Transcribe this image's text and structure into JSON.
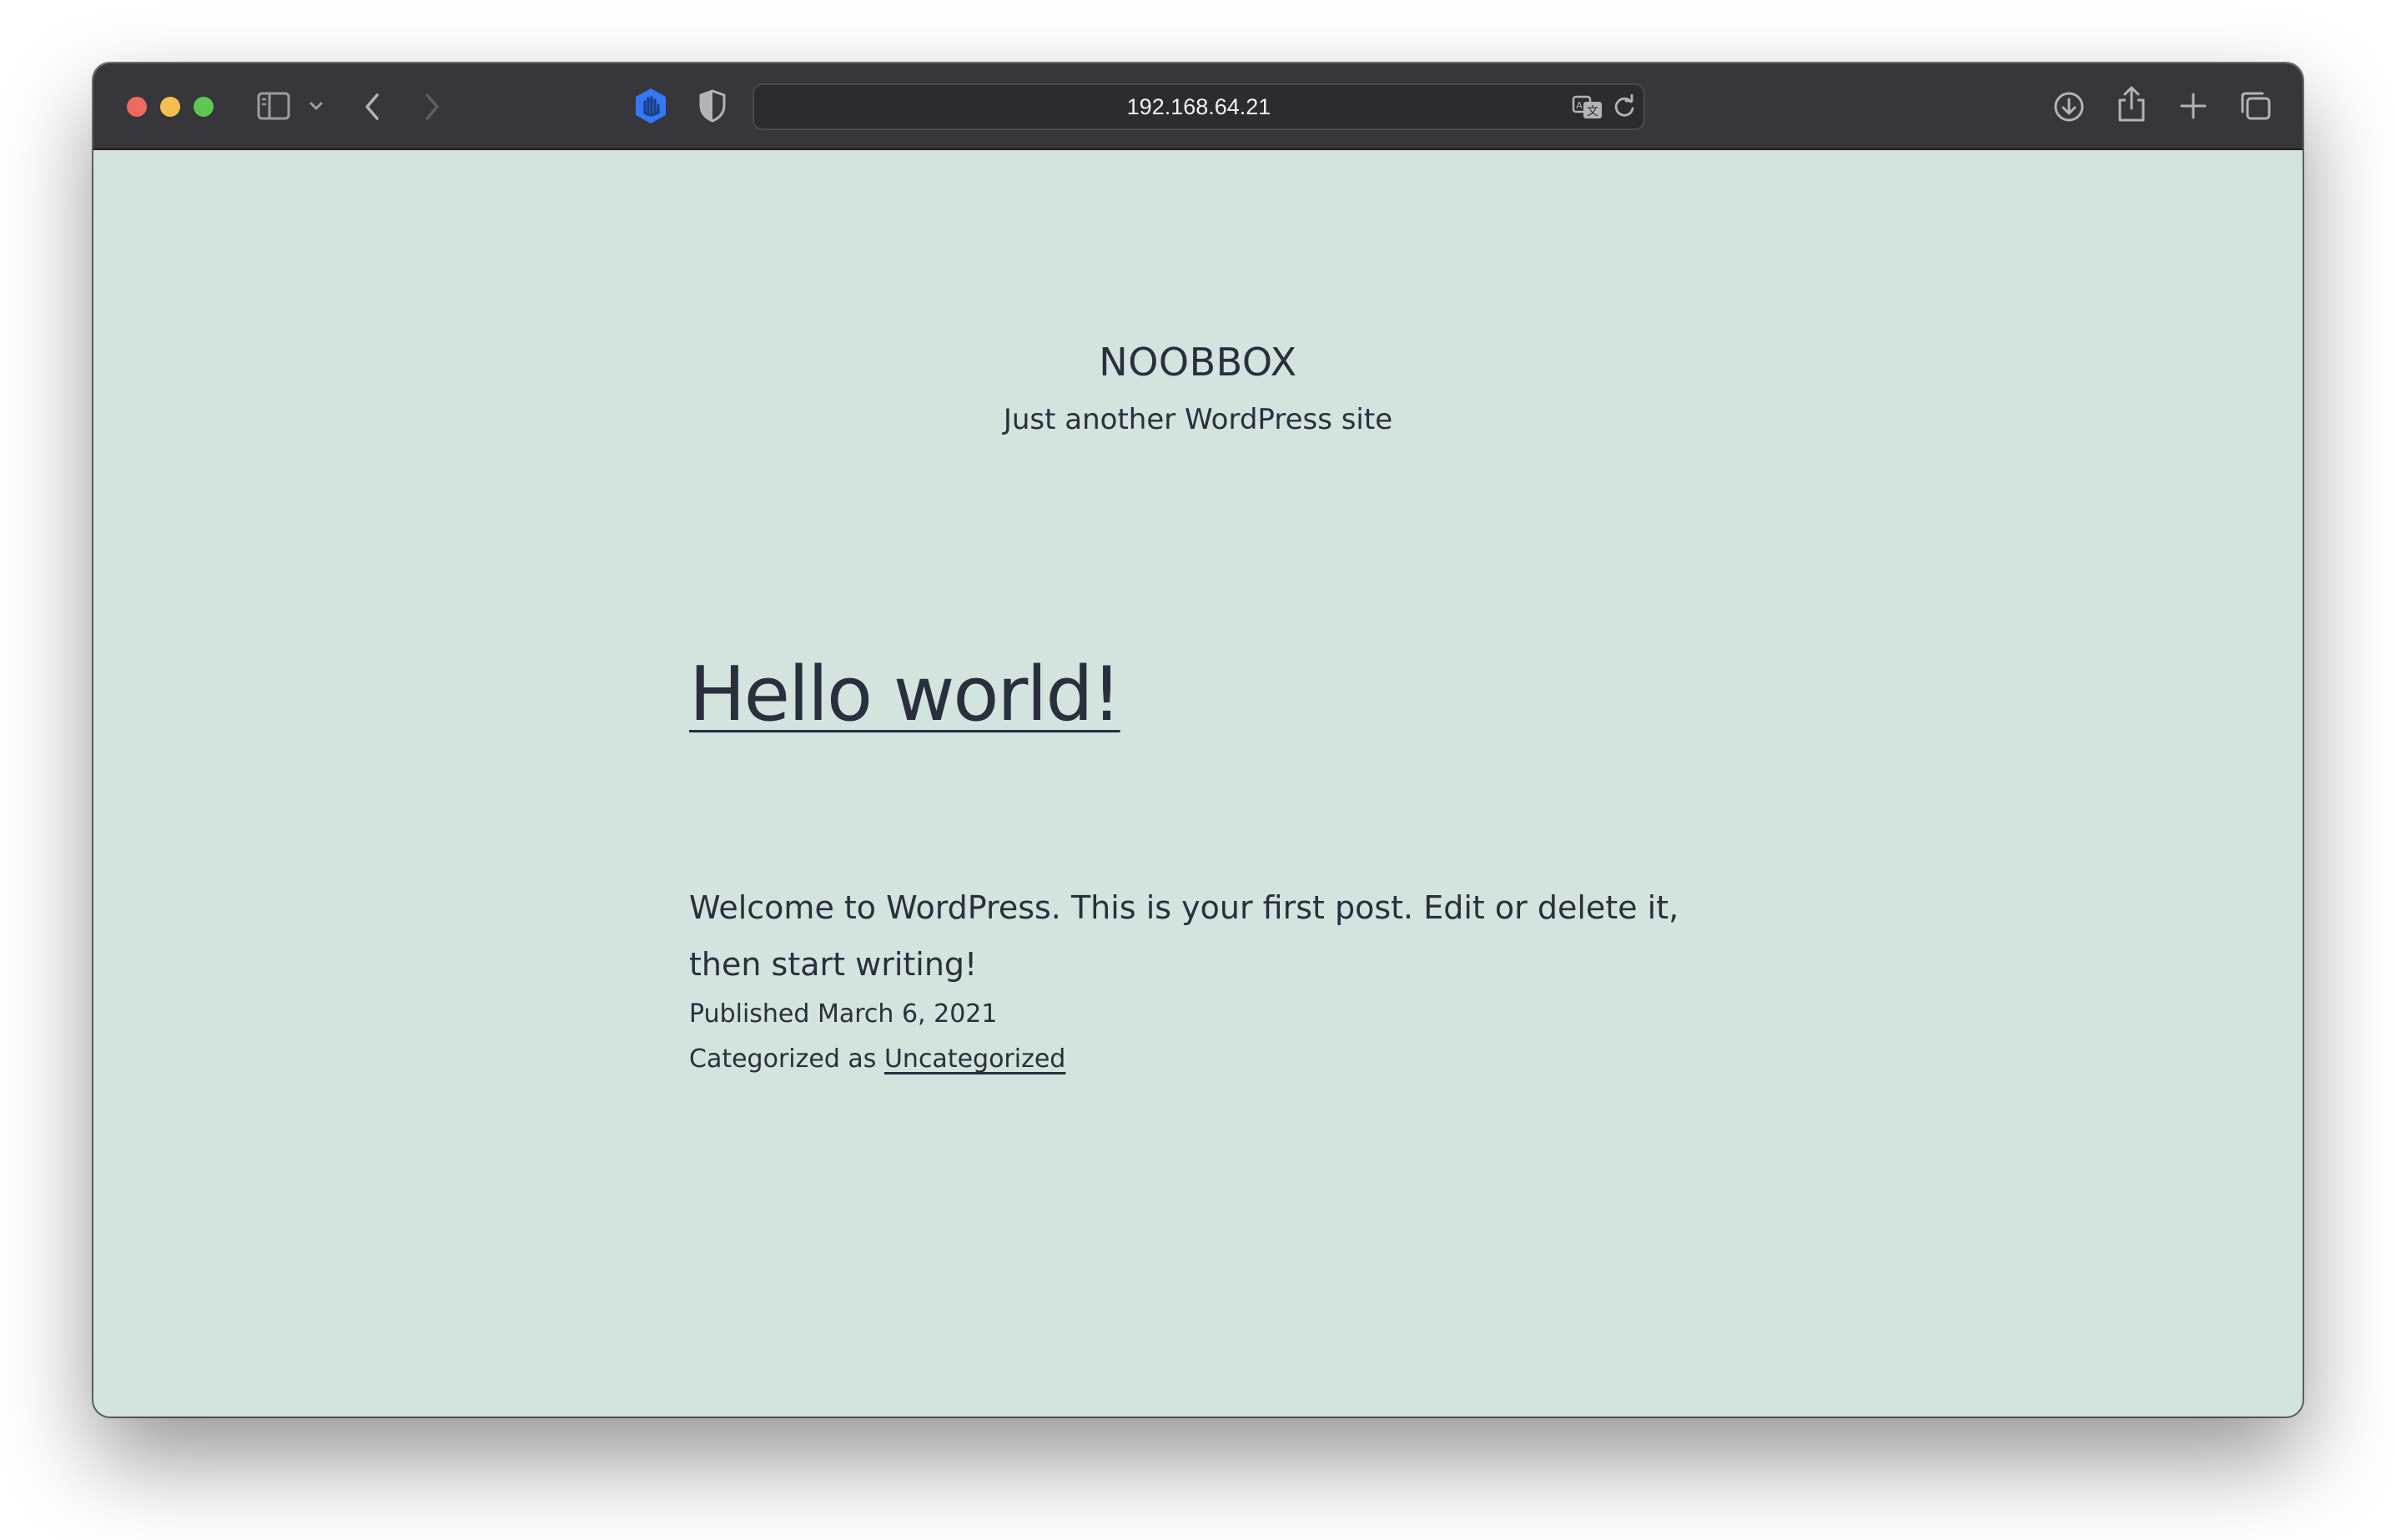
{
  "browser": {
    "url": "192.168.64.21",
    "icons": [
      "sidebar-icon",
      "chevron-down-icon",
      "back-icon",
      "forward-icon",
      "extension-hand-icon",
      "privacy-shield-icon",
      "translate-icon",
      "reload-icon",
      "download-icon",
      "share-icon",
      "new-tab-icon",
      "tab-overview-icon"
    ],
    "colors": {
      "toolbar": "#37363a",
      "page_background": "#d3e3dd",
      "text": "#28303d",
      "close": "#ed6a5e",
      "minimize": "#f5bf4f",
      "maximize": "#61c554",
      "extension_accent": "#3478f6"
    }
  },
  "site": {
    "title": "NOOBBOX",
    "tagline": "Just another WordPress site"
  },
  "post": {
    "title": "Hello world!",
    "body": "Welcome to WordPress. This is your first post. Edit or delete it, then start writing!",
    "published_label": "Published",
    "published_date": "March 6, 2021",
    "categorized_label": "Categorized as",
    "category": "Uncategorized"
  }
}
